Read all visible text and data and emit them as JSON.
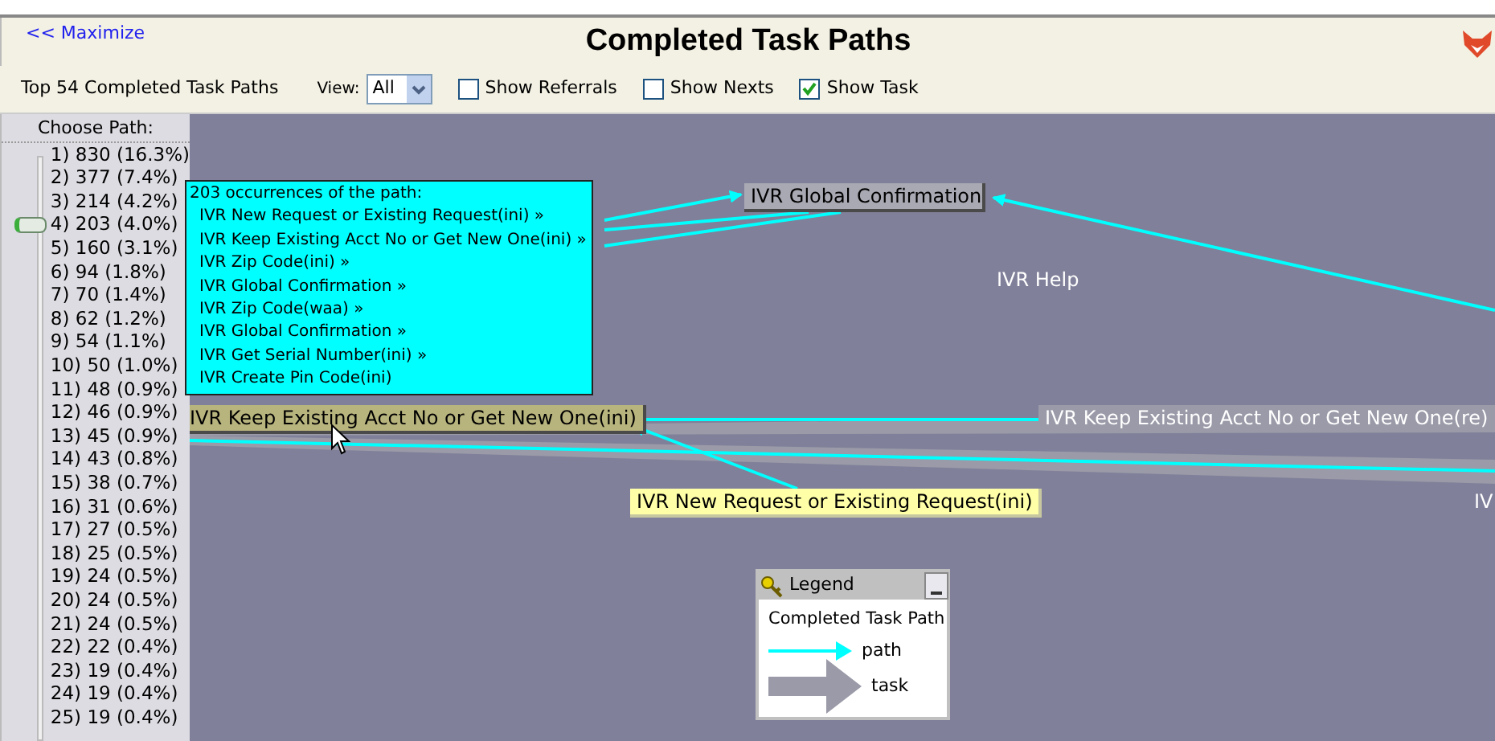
{
  "header": {
    "maximize_link": "<< Maximize",
    "title": "Completed Task Paths"
  },
  "toolbar": {
    "summary": "Top 54 Completed Task Paths",
    "view_label": "View:",
    "view_value": "All",
    "checkboxes": [
      {
        "label": "Show Referrals",
        "checked": false
      },
      {
        "label": "Show Nexts",
        "checked": false
      },
      {
        "label": "Show Task",
        "checked": true
      }
    ]
  },
  "path_chooser": {
    "title": "Choose Path:",
    "items": [
      {
        "label": "1) 830 (16.3%)",
        "selected": false
      },
      {
        "label": "2) 377 (7.4%)",
        "selected": false
      },
      {
        "label": "3) 214 (4.2%)",
        "selected": false
      },
      {
        "label": "4) 203 (4.0%)",
        "selected": true
      },
      {
        "label": "5) 160 (3.1%)",
        "selected": false
      },
      {
        "label": "6) 94 (1.8%)",
        "selected": false
      },
      {
        "label": "7) 70 (1.4%)",
        "selected": false
      },
      {
        "label": "8) 62 (1.2%)",
        "selected": false
      },
      {
        "label": "9) 54 (1.1%)",
        "selected": false
      },
      {
        "label": "10) 50 (1.0%)",
        "selected": false
      },
      {
        "label": "11) 48 (0.9%)",
        "selected": false
      },
      {
        "label": "12) 46 (0.9%)",
        "selected": false
      },
      {
        "label": "13) 45 (0.9%)",
        "selected": false
      },
      {
        "label": "14) 43 (0.8%)",
        "selected": false
      },
      {
        "label": "15) 38 (0.7%)",
        "selected": false
      },
      {
        "label": "16) 31 (0.6%)",
        "selected": false
      },
      {
        "label": "17) 27 (0.5%)",
        "selected": false
      },
      {
        "label": "18) 25 (0.5%)",
        "selected": false
      },
      {
        "label": "19) 24 (0.5%)",
        "selected": false
      },
      {
        "label": "20) 24 (0.5%)",
        "selected": false
      },
      {
        "label": "21) 24 (0.5%)",
        "selected": false
      },
      {
        "label": "22) 22 (0.4%)",
        "selected": false
      },
      {
        "label": "23) 19 (0.4%)",
        "selected": false
      },
      {
        "label": "24) 19 (0.4%)",
        "selected": false
      },
      {
        "label": "25) 19 (0.4%)",
        "selected": false
      }
    ]
  },
  "canvas": {
    "nodes": [
      {
        "kind": "box",
        "label": "IVR Global Confirmation"
      },
      {
        "kind": "label",
        "label": "IVR Help"
      },
      {
        "kind": "highlighted",
        "label": "IVR Keep Existing Acct No or Get New One(ini)"
      },
      {
        "kind": "band",
        "label": "IVR Keep Existing Acct No or Get New One(re)"
      },
      {
        "kind": "start",
        "label": "IVR New Request or Existing Request(ini)"
      },
      {
        "kind": "label",
        "label": "IV"
      }
    ],
    "tooltip": {
      "heading": "203 occurrences of the path:",
      "steps": [
        "IVR New Request or Existing Request(ini) »",
        "IVR Keep Existing Acct No or Get New One(ini) »",
        "IVR Zip Code(ini) »",
        "IVR Global Confirmation »",
        "IVR Zip Code(waa) »",
        "IVR Global Confirmation »",
        "IVR Get Serial Number(ini) »",
        "IVR Create Pin Code(ini)"
      ]
    },
    "legend": {
      "title": "Legend",
      "heading": "Completed Task Path",
      "items": [
        {
          "kind": "path",
          "label": "path"
        },
        {
          "kind": "task",
          "label": "task"
        }
      ]
    }
  }
}
